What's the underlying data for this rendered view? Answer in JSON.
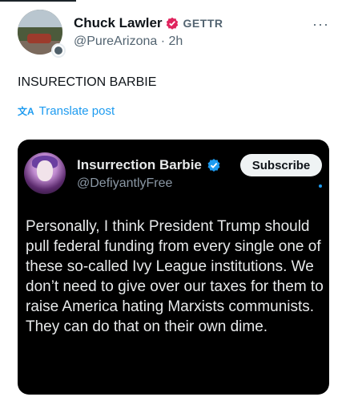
{
  "author": {
    "name": "Chuck Lawler",
    "affiliation": "GETTR",
    "handle": "@PureArizona",
    "separator": "·",
    "time": "2h"
  },
  "post": {
    "text": "INSURECTION BARBIE",
    "translate_label": "Translate post"
  },
  "quoted": {
    "name": "Insurrection Barbie",
    "handle": "@DefiyantlyFree",
    "subscribe_label": "Subscribe",
    "body": "Personally, I think President Trump should pull federal funding from every single one of these so-called Ivy League institutions. We don’t need to give over our taxes for them to raise America hating Marxists communists. They can do that on their own dime."
  },
  "icons": {
    "more": "more-horizontal-icon",
    "translate": "translate-icon",
    "verified": "verified-badge-icon",
    "affiliation": "gettr-logo-icon"
  },
  "colors": {
    "accent": "#1d9bf0",
    "gettr_red": "#e0245e",
    "text_secondary": "#536471",
    "media_bg": "#000000"
  }
}
